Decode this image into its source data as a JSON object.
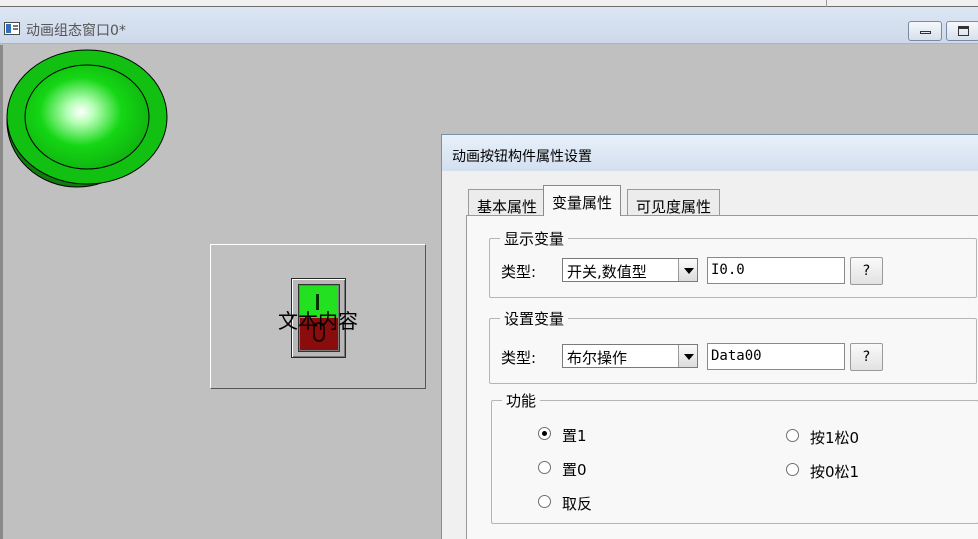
{
  "window": {
    "title": "动画组态窗口0*"
  },
  "canvas": {
    "button_component": {
      "text": "文本内容"
    }
  },
  "dialog": {
    "title": "动画按钮构件属性设置",
    "tabs": [
      {
        "label": "基本属性",
        "selected": false
      },
      {
        "label": "变量属性",
        "selected": true
      },
      {
        "label": "可见度属性",
        "selected": false
      }
    ],
    "display_variable": {
      "group_label": "显示变量",
      "type_label": "类型:",
      "type_value": "开关,数值型",
      "variable_value": "I0.0",
      "browse_label": "?"
    },
    "set_variable": {
      "group_label": "设置变量",
      "type_label": "类型:",
      "type_value": "布尔操作",
      "variable_value": "Data00",
      "browse_label": "?"
    },
    "function": {
      "group_label": "功能",
      "options": [
        {
          "label": "置1",
          "checked": true
        },
        {
          "label": "置0",
          "checked": false
        },
        {
          "label": "取反",
          "checked": false
        },
        {
          "label": "按1松0",
          "checked": false
        },
        {
          "label": "按0松1",
          "checked": false
        }
      ]
    }
  },
  "colors": {
    "lamp_green": "#18d018",
    "toggle_on": "#23e021",
    "toggle_off": "#8a0c0c",
    "canvas_bg": "#c0c0c0"
  }
}
